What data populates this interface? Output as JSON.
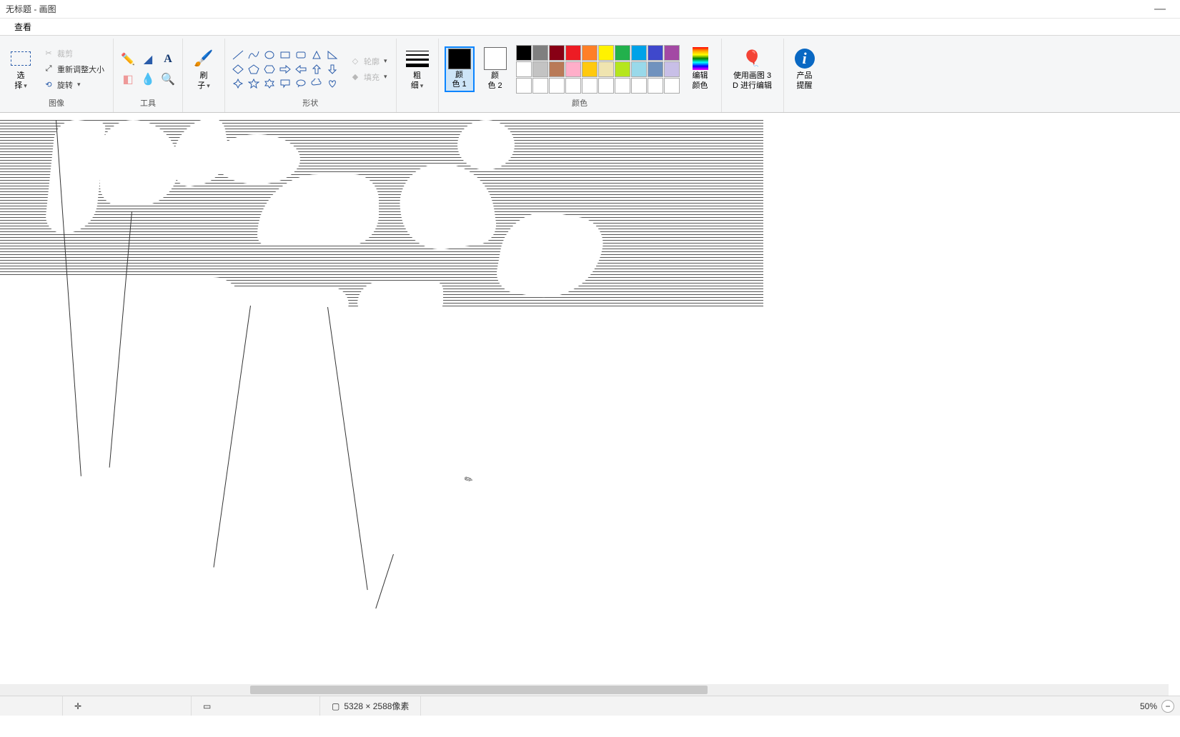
{
  "window": {
    "title": "无标题 - 画图"
  },
  "menu": {
    "view": "查看"
  },
  "ribbon": {
    "image": {
      "select": "选\n择",
      "crop": "裁剪",
      "resize": "重新调整大小",
      "rotate": "旋转",
      "label": "图像"
    },
    "tools": {
      "label": "工具"
    },
    "brushes": {
      "label": "刷\n子"
    },
    "shapes": {
      "outline": "轮廓",
      "fill": "填充",
      "label": "形状"
    },
    "stroke": {
      "label": "粗\n细"
    },
    "color1": {
      "label": "颜\n色 1"
    },
    "color2": {
      "label": "颜\n色 2"
    },
    "colors": {
      "label": "颜色"
    },
    "editcolors": {
      "label": "编辑\n颜色"
    },
    "paint3d": {
      "label": "使用画图 3\nD 进行编辑"
    },
    "product": {
      "label": "产品\n提醒"
    }
  },
  "palette": {
    "row1": [
      "#000000",
      "#7f7f7f",
      "#880015",
      "#ed1c24",
      "#ff7f27",
      "#fff200",
      "#22b14c",
      "#00a2e8",
      "#3f48cc",
      "#a349a4"
    ],
    "row2": [
      "#ffffff",
      "#c3c3c3",
      "#b97a57",
      "#ffaec9",
      "#ffc90e",
      "#efe4b0",
      "#b5e61d",
      "#99d9ea",
      "#7092be",
      "#c8bfe7"
    ],
    "row3": [
      "#ffffff",
      "#ffffff",
      "#ffffff",
      "#ffffff",
      "#ffffff",
      "#ffffff",
      "#ffffff",
      "#ffffff",
      "#ffffff",
      "#ffffff"
    ]
  },
  "status": {
    "dimensions": "5328 × 2588像素",
    "zoom": "50%"
  }
}
